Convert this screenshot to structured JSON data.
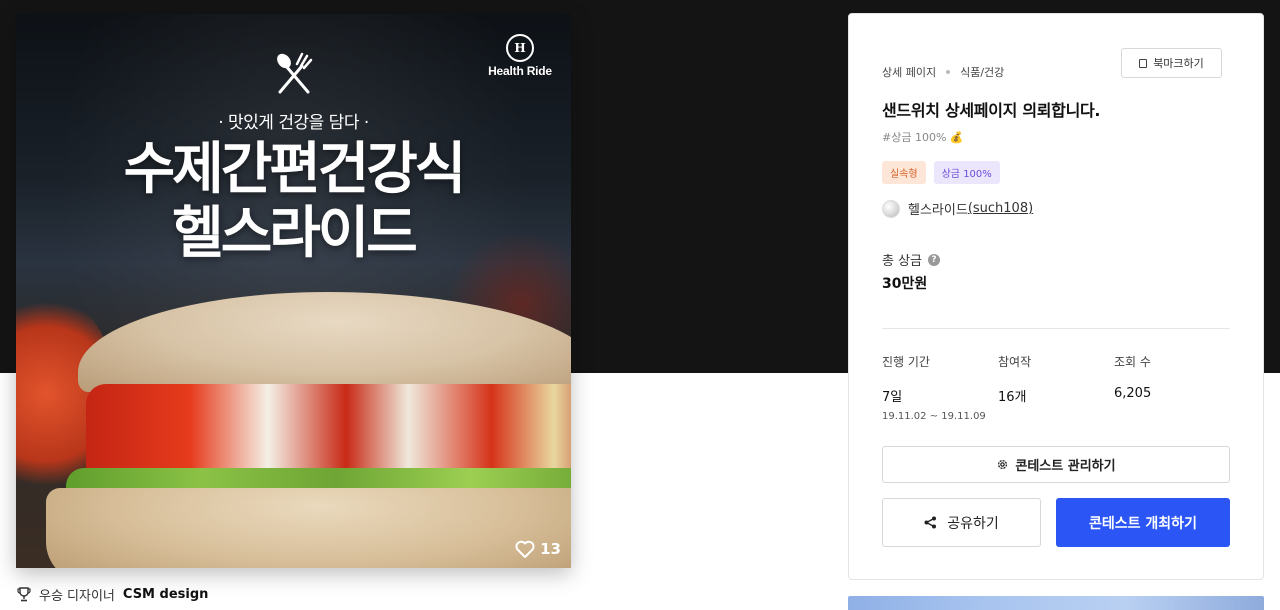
{
  "image_card": {
    "tagline": "· 맛있게 건강을 담다 ·",
    "headline_line1": "수제간편건강식",
    "headline_line2": "헬스라이드",
    "brand_logo_text": "Health Ride",
    "brand_logo_mark": "H",
    "likes": "13"
  },
  "designer": {
    "label": "우승 디자이너",
    "name": "CSM design"
  },
  "panel": {
    "breadcrumb": [
      "상세 페이지",
      "식품/건강"
    ],
    "bookmark_label": "북마크하기",
    "title": "샌드위치 상세페이지 의뢰합니다.",
    "hashtag": "#상금 100% 💰",
    "tags": [
      "실속형",
      "상금 100%"
    ],
    "author_name": "헬스라이드",
    "author_handle": "(such108)",
    "prize_label": "총 상금",
    "prize_help": "?",
    "prize_value": "30만원",
    "stats": {
      "period_label": "진행 기간",
      "period_value": "7일",
      "period_range": "19.11.02 ~ 19.11.09",
      "participants_label": "참여작",
      "participants_value": "16개",
      "views_label": "조회 수",
      "views_value": "6,205"
    },
    "manage_label": "콘테스트 관리하기",
    "share_label": "공유하기",
    "host_label": "콘테스트 개최하기"
  },
  "colors": {
    "primary": "#2b56f5",
    "tag_orange_bg": "#fde6d7",
    "tag_purple_bg": "#ece6fd",
    "top_band": "#141414"
  },
  "icons": [
    "fork-knife-icon",
    "heart-icon",
    "trophy-icon",
    "bookmark-icon",
    "help-icon",
    "gear-icon",
    "share-icon"
  ]
}
